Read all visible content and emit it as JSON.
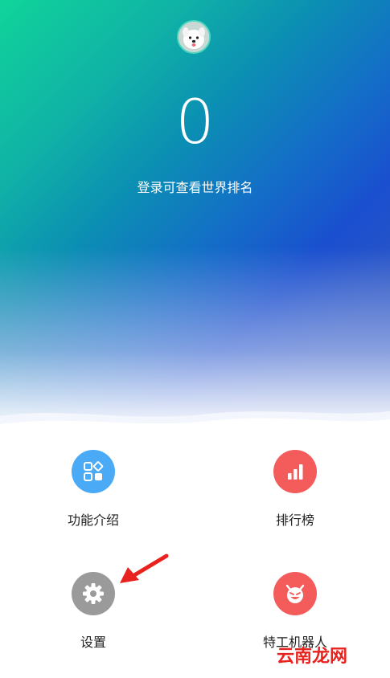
{
  "header": {
    "avatar": "samoyed-dog-avatar",
    "score": "0",
    "login_hint": "登录可查看世界排名"
  },
  "menu": {
    "features": {
      "label": "功能介绍",
      "icon": "apps-grid-icon",
      "color": "#4aaaf5"
    },
    "ranking": {
      "label": "排行榜",
      "icon": "bar-chart-icon",
      "color": "#f45b5b"
    },
    "settings": {
      "label": "设置",
      "icon": "gear-icon",
      "color": "#9a9a9a"
    },
    "agent_bot": {
      "label": "特工机器人",
      "icon": "devil-face-icon",
      "color": "#f45b5b"
    }
  },
  "watermark": "云南龙网",
  "colors": {
    "gradient_start": "#10d49a",
    "gradient_end": "#1a4fcf",
    "arrow": "#e8231f"
  }
}
